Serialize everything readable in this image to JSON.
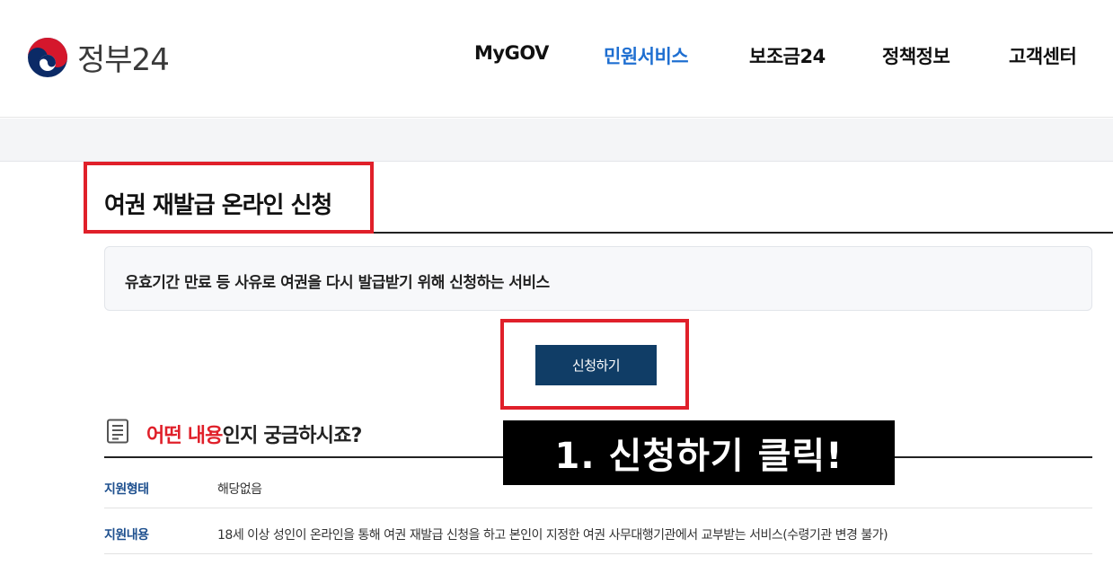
{
  "header": {
    "logo_text": "정부24",
    "nav": [
      {
        "label": "MyGOV",
        "active": false
      },
      {
        "label": "민원서비스",
        "active": true
      },
      {
        "label": "보조금24",
        "active": false
      },
      {
        "label": "정책정보",
        "active": false
      },
      {
        "label": "고객센터",
        "active": false
      }
    ]
  },
  "page": {
    "title": "여권 재발급 온라인 신청",
    "description": "유효기간 만료 등 사유로 여권을 다시 발급받기 위해 신청하는 서비스",
    "apply_button": "신청하기"
  },
  "section": {
    "title_highlight": "어떤 내용",
    "title_rest": "인지 궁금하시죠?",
    "rows": [
      {
        "label": "지원형태",
        "value": "해당없음"
      },
      {
        "label": "지원내용",
        "value": "18세 이상 성인이 온라인을 통해 여권 재발급 신청을 하고 본인이 지정한 여권 사무대행기관에서 교부받는 서비스(수령기관 변경 불가)"
      }
    ]
  },
  "annotation": {
    "text": "1. 신청하기 클릭!"
  },
  "colors": {
    "accent_blue": "#1f6fd1",
    "button_navy": "#103d66",
    "highlight_red": "#e0202a",
    "label_blue": "#1d4f8e"
  }
}
